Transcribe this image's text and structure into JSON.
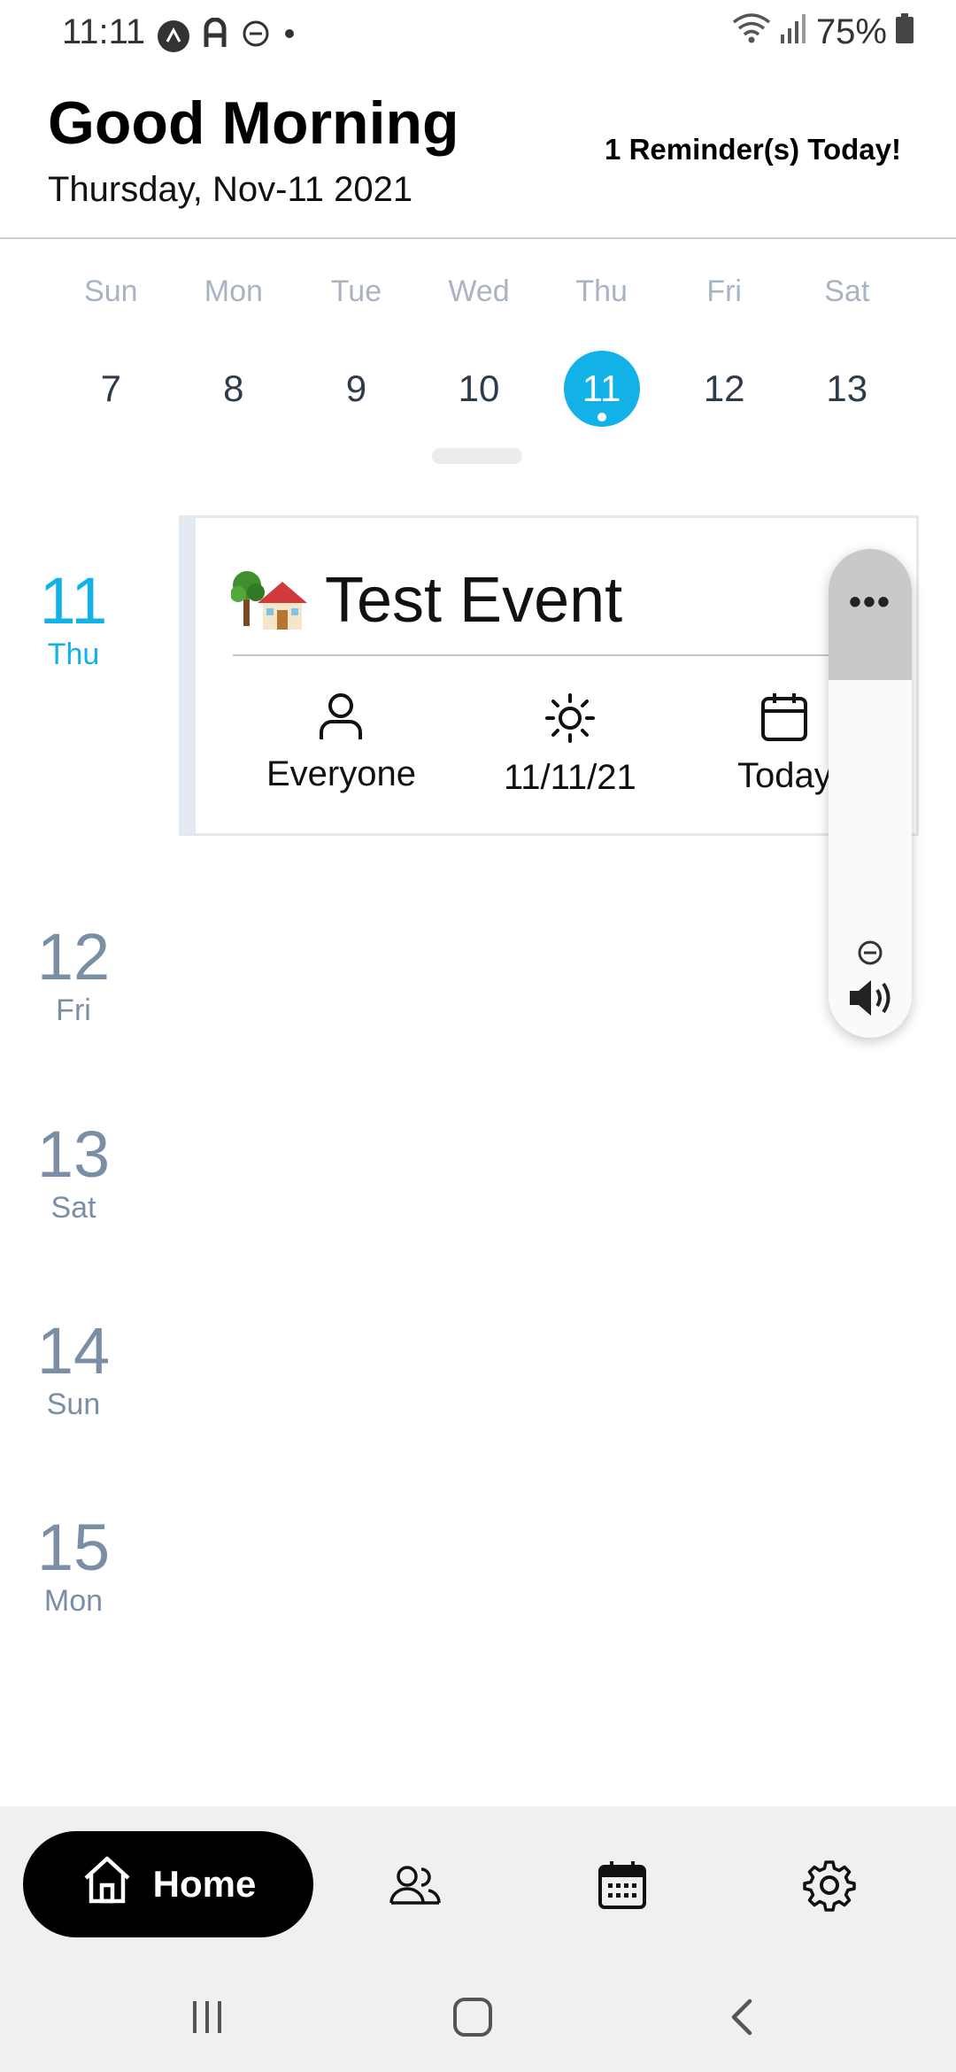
{
  "status_bar": {
    "time": "11:11",
    "battery": "75%"
  },
  "header": {
    "greeting": "Good Morning",
    "date": "Thursday, Nov-11 2021",
    "reminder": "1 Reminder(s) Today!"
  },
  "week": {
    "days": [
      {
        "name": "Sun",
        "num": "7"
      },
      {
        "name": "Mon",
        "num": "8"
      },
      {
        "name": "Tue",
        "num": "9"
      },
      {
        "name": "Wed",
        "num": "10"
      },
      {
        "name": "Thu",
        "num": "11"
      },
      {
        "name": "Fri",
        "num": "12"
      },
      {
        "name": "Sat",
        "num": "13"
      }
    ],
    "selected_index": 4
  },
  "agenda": {
    "days": [
      {
        "num": "11",
        "name": "Thu"
      },
      {
        "num": "12",
        "name": "Fri"
      },
      {
        "num": "13",
        "name": "Sat"
      },
      {
        "num": "14",
        "name": "Sun"
      },
      {
        "num": "15",
        "name": "Mon"
      }
    ]
  },
  "event": {
    "emoji_icon": "house-with-tree-emoji",
    "title": "Test Event",
    "assignee": "Everyone",
    "date": "11/11/21",
    "when": "Today"
  },
  "volume_panel": {
    "more_label": "•••"
  },
  "nav": {
    "home_label": "Home"
  },
  "colors": {
    "accent": "#12b1e8",
    "muted_day": "#7a8fa6",
    "nav_bg": "#f0f0f0"
  }
}
